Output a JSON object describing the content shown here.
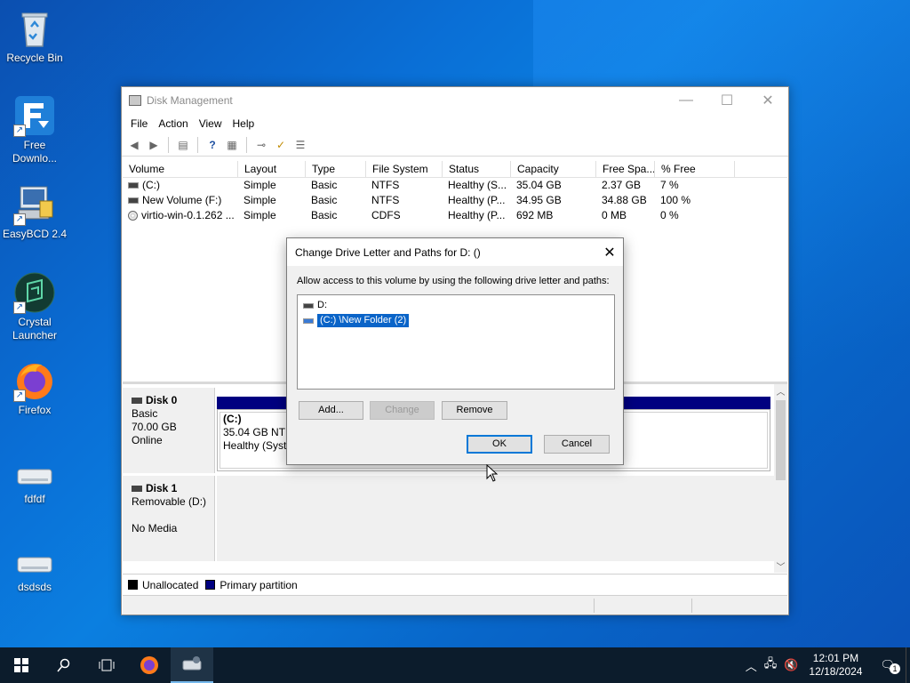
{
  "desktop": {
    "icons": [
      {
        "label": "Recycle Bin",
        "icon": "recycle-bin-icon"
      },
      {
        "label": "Free Downlo...",
        "icon": "free-download-manager-icon"
      },
      {
        "label": "EasyBCD 2.4",
        "icon": "easybcd-icon"
      },
      {
        "label": "Crystal Launcher",
        "icon": "crystal-launcher-icon"
      },
      {
        "label": "Firefox",
        "icon": "firefox-icon"
      },
      {
        "label": "fdfdf",
        "icon": "drive-icon"
      },
      {
        "label": "dsdsds",
        "icon": "drive-icon"
      }
    ]
  },
  "window": {
    "title": "Disk Management",
    "menu": [
      "File",
      "Action",
      "View",
      "Help"
    ],
    "columns": [
      "Volume",
      "Layout",
      "Type",
      "File System",
      "Status",
      "Capacity",
      "Free Spa...",
      "% Free"
    ],
    "volumes": [
      {
        "volume": "(C:)",
        "layout": "Simple",
        "type": "Basic",
        "fs": "NTFS",
        "status": "Healthy (S...",
        "capacity": "35.04 GB",
        "free": "2.37 GB",
        "pct": "7 %",
        "icon": "drive"
      },
      {
        "volume": "New Volume (F:)",
        "layout": "Simple",
        "type": "Basic",
        "fs": "NTFS",
        "status": "Healthy (P...",
        "capacity": "34.95 GB",
        "free": "34.88 GB",
        "pct": "100 %",
        "icon": "drive"
      },
      {
        "volume": "virtio-win-0.1.262 ...",
        "layout": "Simple",
        "type": "Basic",
        "fs": "CDFS",
        "status": "Healthy (P...",
        "capacity": "692 MB",
        "free": "0 MB",
        "pct": "0 %",
        "icon": "cd"
      }
    ],
    "disks": [
      {
        "name": "Disk 0",
        "kind": "Basic",
        "size": "70.00 GB",
        "state": "Online",
        "partition": {
          "name": "(C:)",
          "detail": "35.04 GB NTFS",
          "status": "Healthy (Syste"
        }
      },
      {
        "name": "Disk 1",
        "kind": "Removable (D:)",
        "size": "",
        "state": "No Media"
      }
    ],
    "legend": [
      "Unallocated",
      "Primary partition"
    ],
    "legend_colors": [
      "#000000",
      "#000080"
    ]
  },
  "dialog": {
    "title": "Change Drive Letter and Paths for D: ()",
    "description": "Allow access to this volume by using the following drive letter and paths:",
    "paths": [
      {
        "label": "D:",
        "selected": false
      },
      {
        "label": "(C:) \\New Folder (2)",
        "selected": true
      }
    ],
    "buttons": {
      "add": "Add...",
      "change": "Change",
      "remove": "Remove",
      "ok": "OK",
      "cancel": "Cancel"
    }
  },
  "taskbar": {
    "time": "12:01 PM",
    "date": "12/18/2024",
    "notification_count": "1"
  }
}
